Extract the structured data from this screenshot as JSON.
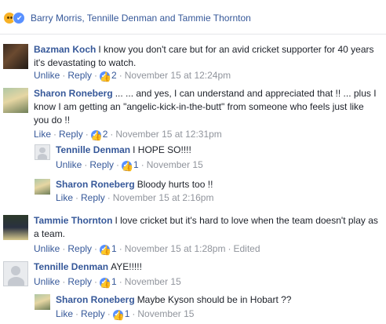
{
  "reactions": {
    "names": "Barry Morris, Tennille Denman and Tammie Thornton"
  },
  "comments": [
    {
      "author": "Bazman Koch",
      "text": "I know you don't care but for an avid cricket supporter for 40 years it's devastating to watch.",
      "actions": {
        "primary": "Unlike",
        "reply": "Reply",
        "count": "2",
        "time": "November 15 at 12:24pm",
        "edited": ""
      }
    },
    {
      "author": "Sharon Roneberg",
      "text": "... ... and yes, I can understand and appreciated that !! ... plus I know I am getting an \"angelic-kick-in-the-butt\" from someone who feels just like you do !!",
      "actions": {
        "primary": "Like",
        "reply": "Reply",
        "count": "2",
        "time": "November 15 at 12:31pm",
        "edited": ""
      }
    },
    {
      "author": "Tennille Denman",
      "text": "I HOPE SO!!!!",
      "actions": {
        "primary": "Unlike",
        "reply": "Reply",
        "count": "1",
        "time": "November 15",
        "edited": ""
      }
    },
    {
      "author": "Sharon Roneberg",
      "text": "Bloody hurts too !!",
      "actions": {
        "primary": "Like",
        "reply": "Reply",
        "count": "",
        "time": "November 15 at 2:16pm",
        "edited": ""
      }
    },
    {
      "author": "Tammie Thornton",
      "text": "I love cricket but it's hard to love when the team doesn't play as a team.",
      "actions": {
        "primary": "Unlike",
        "reply": "Reply",
        "count": "1",
        "time": "November 15 at 1:28pm",
        "edited": "Edited"
      }
    },
    {
      "author": "Tennille Denman",
      "text": "AYE!!!!!",
      "actions": {
        "primary": "Unlike",
        "reply": "Reply",
        "count": "1",
        "time": "November 15",
        "edited": ""
      }
    },
    {
      "author": "Sharon Roneberg",
      "text": "Maybe Kyson should be in Hobart ??",
      "actions": {
        "primary": "Like",
        "reply": "Reply",
        "count": "1",
        "time": "November 15",
        "edited": ""
      }
    }
  ]
}
